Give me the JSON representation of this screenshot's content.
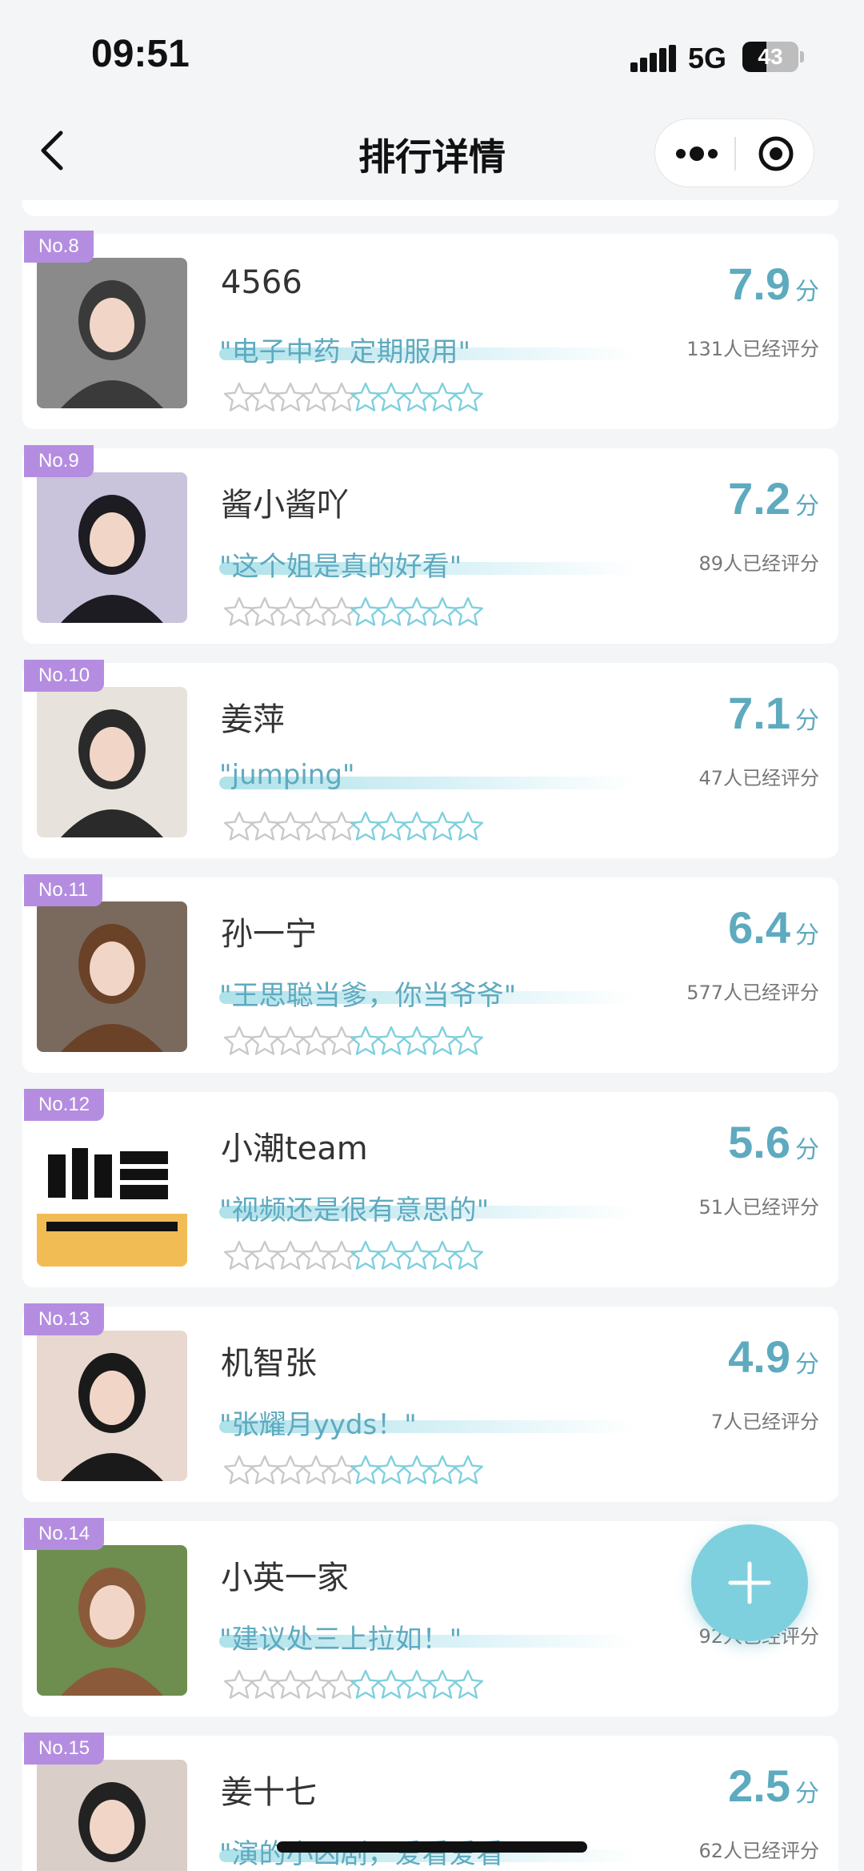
{
  "status_bar": {
    "time": "09:51",
    "network": "5G",
    "battery": "43",
    "battery_level": 0.43
  },
  "nav": {
    "title": "排行详情",
    "back_icon": "chevron-left-icon",
    "more_icon": "more-dots-icon",
    "close_icon": "target-circle-icon"
  },
  "colors": {
    "accent": "#5eaabf",
    "badge": "#b48de0",
    "fab": "#7fd0de"
  },
  "score_unit": "分",
  "items": [
    {
      "rank": "No.8",
      "name": "4566",
      "quote": "\"电子中药 定期服用\"",
      "score": "7.9",
      "count": "131人已经评分",
      "avatar_color": "#3a3a3a",
      "avatar_bg": "#8a8a8a"
    },
    {
      "rank": "No.9",
      "name": "酱小酱吖",
      "quote": "\"这个姐是真的好看\"",
      "score": "7.2",
      "count": "89人已经评分",
      "avatar_color": "#1c1c22",
      "avatar_bg": "#c9c3dc"
    },
    {
      "rank": "No.10",
      "name": "姜萍",
      "quote": "\"jumping\"",
      "score": "7.1",
      "count": "47人已经评分",
      "avatar_color": "#2a2a2a",
      "avatar_bg": "#e8e2dc"
    },
    {
      "rank": "No.11",
      "name": "孙一宁",
      "quote": "\"王思聪当爹，你当爷爷\"",
      "score": "6.4",
      "count": "577人已经评分",
      "avatar_color": "#6a4228",
      "avatar_bg": "#7a6a5e"
    },
    {
      "rank": "No.12",
      "name": "小潮team",
      "quote": "\"视频还是很有意思的\"",
      "score": "5.6",
      "count": "51人已经评分",
      "avatar_color": "#111111",
      "avatar_bg": "#ffffff"
    },
    {
      "rank": "No.13",
      "name": "机智张",
      "quote": "\"张耀月yyds！\"",
      "score": "4.9",
      "count": "7人已经评分",
      "avatar_color": "#1a1a1a",
      "avatar_bg": "#e9d8cf"
    },
    {
      "rank": "No.14",
      "name": "小英一家",
      "quote": "\"建议处三上拉如！\"",
      "score": "",
      "count": "92人已经评分",
      "avatar_color": "#8a5a3a",
      "avatar_bg": "#6d8e4e"
    },
    {
      "rank": "No.15",
      "name": "姜十七",
      "quote": "\"演的小凶剧，爱看爱看\"",
      "score": "2.5",
      "count": "62人已经评分",
      "avatar_color": "#222222",
      "avatar_bg": "#d9cfc8"
    }
  ],
  "fab_icon": "plus-icon",
  "star_icon": "star-outline-icon"
}
